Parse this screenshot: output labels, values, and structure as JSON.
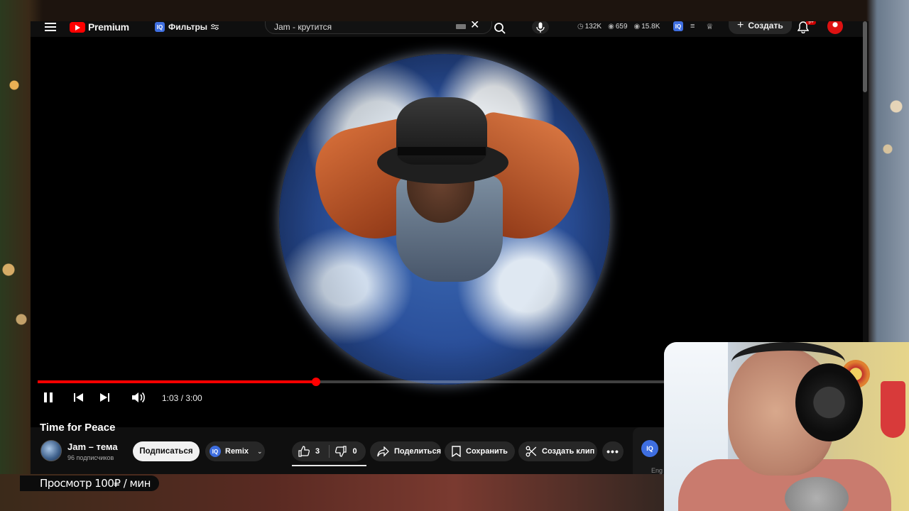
{
  "header": {
    "logo_text": "Premium",
    "filters_label": "Фильтры",
    "search_query": "Jam - крутится",
    "stats": {
      "views": "132K",
      "watching": "659",
      "other": "15.8K"
    },
    "create_label": "Создать",
    "notifications_count": "9+"
  },
  "player": {
    "current_time": "1:03",
    "duration": "3:00",
    "time_display": "1:03 / 3:00",
    "progress_fraction": 0.35,
    "state": "playing"
  },
  "video": {
    "title": "Time for Peace",
    "channel_name": "Jam – тема",
    "subscribers": "96 подписчиков",
    "subscribe_label": "Подписаться",
    "remix_label": "Remix",
    "likes": "3",
    "dislikes": "0",
    "share_label": "Поделиться",
    "save_label": "Сохранить",
    "clip_label": "Создать клип",
    "side_label": "Eng"
  },
  "overlay": {
    "price_text": "Просмотр 100₽ / мин"
  },
  "colors": {
    "accent": "#ff0000",
    "iq_blue": "#3e6ee0",
    "background": "#0f0f0f"
  }
}
